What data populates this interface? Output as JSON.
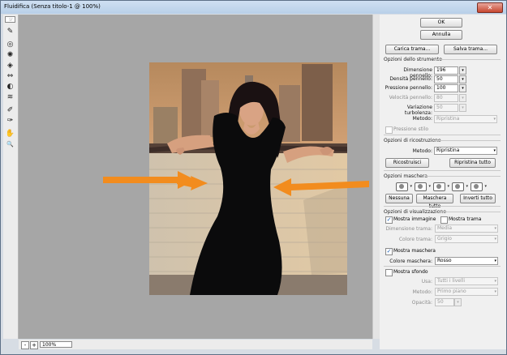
{
  "window": {
    "title": "Fluidifica (Senza titolo-1 @ 100%)",
    "close_glyph": "✕"
  },
  "tools": [
    {
      "name": "forward-warp-tool-icon",
      "glyph": "☞"
    },
    {
      "name": "reconstruct-tool-icon",
      "glyph": "✎"
    },
    {
      "name": "twirl-clockwise-tool-icon",
      "glyph": "◎"
    },
    {
      "name": "pucker-tool-icon",
      "glyph": "✺"
    },
    {
      "name": "bloat-tool-icon",
      "glyph": "◈"
    },
    {
      "name": "push-left-tool-icon",
      "glyph": "⇔"
    },
    {
      "name": "mirror-tool-icon",
      "glyph": "◐"
    },
    {
      "name": "turbulence-tool-icon",
      "glyph": "≋"
    },
    {
      "name": "freeze-mask-tool-icon",
      "glyph": "✐"
    },
    {
      "name": "thaw-mask-tool-icon",
      "glyph": "✑"
    },
    {
      "name": "hand-tool-icon",
      "glyph": "✋"
    },
    {
      "name": "zoom-tool-icon",
      "glyph": "🔍"
    }
  ],
  "status": {
    "minus": "-",
    "plus": "+",
    "zoom": "100%"
  },
  "buttons": {
    "ok": "OK",
    "cancel": "Annulla",
    "load_mesh": "Carica trama...",
    "save_mesh": "Salva trama..."
  },
  "tool_options": {
    "header": "Opzioni dello strumento",
    "brush_size_label": "Dimensione pennello:",
    "brush_size": "196",
    "brush_density_label": "Densità pennello:",
    "brush_density": "50",
    "brush_pressure_label": "Pressione pennello:",
    "brush_pressure": "100",
    "brush_rate_label": "Velocità pennello:",
    "brush_rate": "80",
    "turbulent_jitter_label": "Variazione turbolenza:",
    "turbulent_jitter": "50",
    "mode_label": "Metodo:",
    "mode": "Ripristina",
    "stylus_pressure": "Pressione stilo"
  },
  "reconstruct_options": {
    "header": "Opzioni di ricostruzione",
    "mode_label": "Metodo:",
    "mode": "Ripristina",
    "reconstruct": "Ricostruisci",
    "restore_all": "Ripristina tutto"
  },
  "mask_options": {
    "header": "Opzioni maschera",
    "none": "Nessuna",
    "mask_all": "Maschera tutto",
    "invert_all": "Inverti tutto"
  },
  "view_options": {
    "header": "Opzioni di visualizzazione",
    "show_image": "Mostra immagine",
    "show_mesh": "Mostra trama",
    "mesh_size_label": "Dimensione trama:",
    "mesh_size": "Media",
    "mesh_color_label": "Colore trama:",
    "mesh_color": "Grigio",
    "show_mask": "Mostra maschera",
    "mask_color_label": "Colore maschera:",
    "mask_color": "Rosso"
  },
  "backdrop": {
    "show_backdrop": "Mostra sfondo",
    "use_label": "Usa:",
    "use": "Tutti i livelli",
    "mode_label": "Metodo:",
    "mode": "Primo piano",
    "opacity_label": "Opacità:",
    "opacity": "50"
  },
  "colors": {
    "arrow": "#f28c1e",
    "dress": "#0b0b0c",
    "sky": "#b98b5e",
    "wall": "#d9cab2"
  }
}
